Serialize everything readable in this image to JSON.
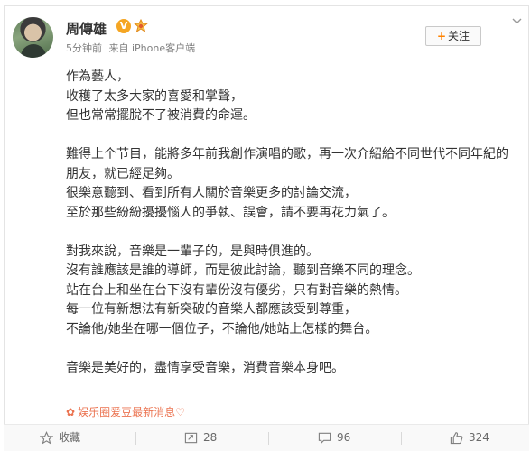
{
  "post": {
    "username": "周傳雄",
    "verified_badge": "V",
    "member_icon": "member-icon",
    "time": "5分钟前",
    "source": "来自 iPhone客户端",
    "follow_label": "关注",
    "more_icon": "chevron-down-icon",
    "lines": [
      "作為藝人，",
      "收穫了太多大家的喜愛和掌聲，",
      "但也常常擺脫不了被消費的命運。",
      "",
      "難得上个节目，能將多年前我創作演唱的歌，再一次介紹給不同世代不同年紀的",
      "朋友，就已經足夠。",
      "很樂意聽到、看到所有人關於音樂更多的討論交流，",
      "至於那些紛紛擾擾惱人的爭執、誤會，請不要再花力氣了。",
      "",
      "對我來說，音樂是一輩子的，是與時俱進的。",
      "沒有誰應該是誰的導師，而是彼此討論，聽到音樂不同的理念。",
      "站在台上和坐在台下沒有輩份沒有優劣，只有對音樂的熱情。",
      "每一位有新想法有新突破的音樂人都應該受到尊重，",
      "不論他/她坐在哪一個位子，不論他/她站上怎樣的舞台。",
      "",
      "音樂是美好的，盡情享受音樂，消費音樂本身吧。"
    ],
    "tag": "娱乐圈爱豆最新消息♡"
  },
  "actions": {
    "favorite": "收藏",
    "repost": "28",
    "comment": "96",
    "like": "324"
  },
  "colors": {
    "accent": "#ff8200",
    "tag": "#eb7350",
    "badge": "#f5a623"
  }
}
